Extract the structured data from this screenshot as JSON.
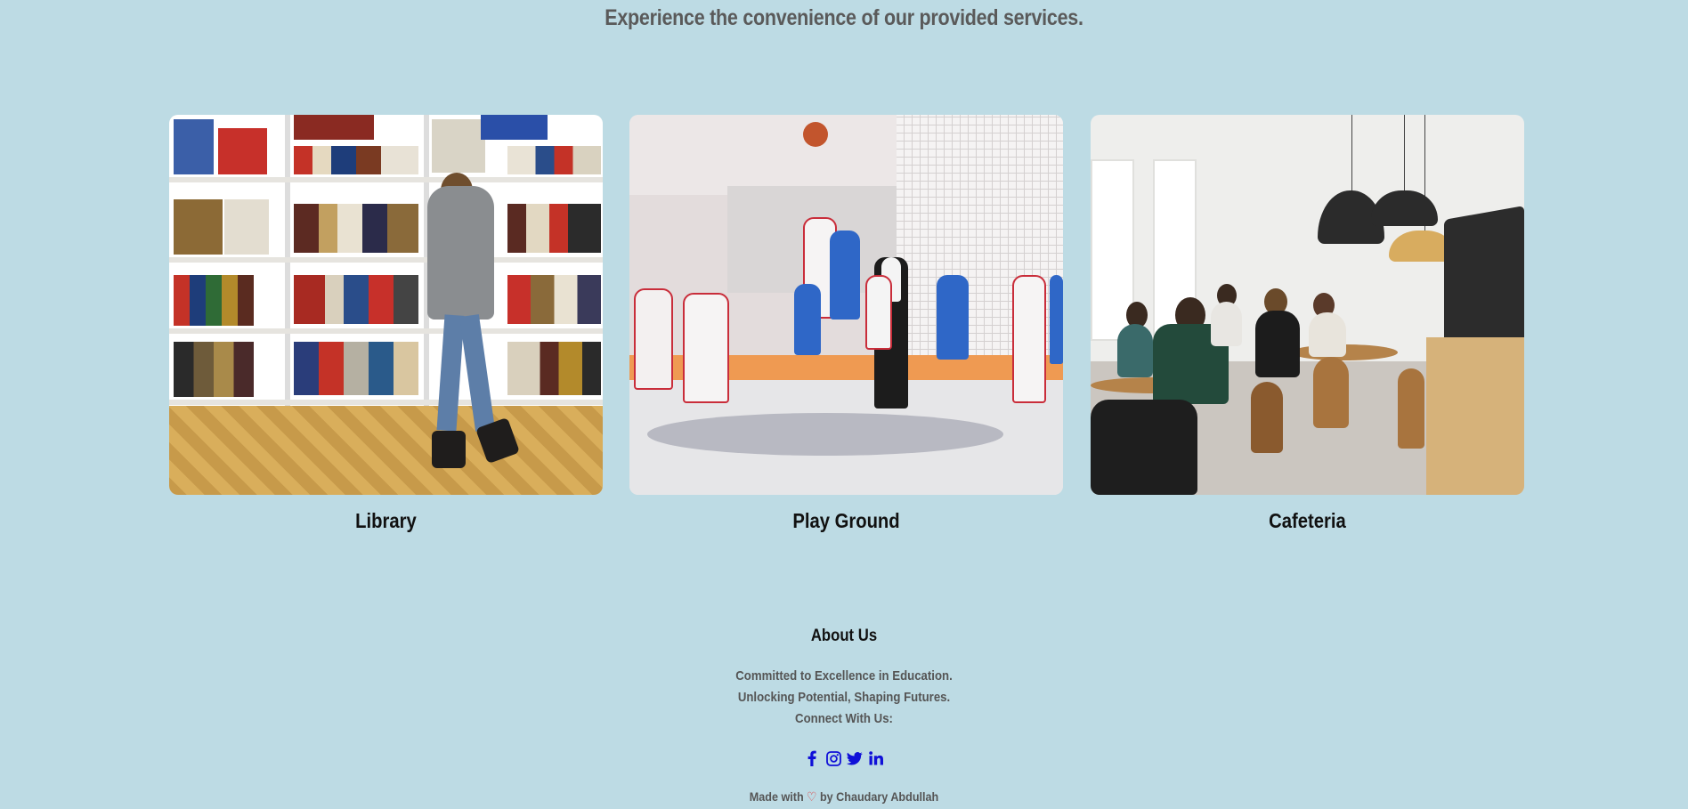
{
  "header": {
    "tagline": "Experience the convenience of our provided services."
  },
  "services": [
    {
      "title": "Library",
      "image": "library-photo"
    },
    {
      "title": "Play Ground",
      "image": "basketball-court-photo"
    },
    {
      "title": "Cafeteria",
      "image": "cafeteria-photo"
    }
  ],
  "footer": {
    "about_title": "About Us",
    "line1": "Committed to Excellence in Education.",
    "line2": "Unlocking Potential, Shaping Futures.",
    "line3": "Connect With Us:",
    "socials": [
      "facebook-icon",
      "instagram-icon",
      "twitter-icon",
      "linkedin-icon"
    ],
    "credit_prefix": "Made with",
    "credit_suffix": "by Chaudary Abdullah"
  },
  "colors": {
    "background": "#bddbe4",
    "social_icons": "#1010d8",
    "heart": "#e03434"
  }
}
